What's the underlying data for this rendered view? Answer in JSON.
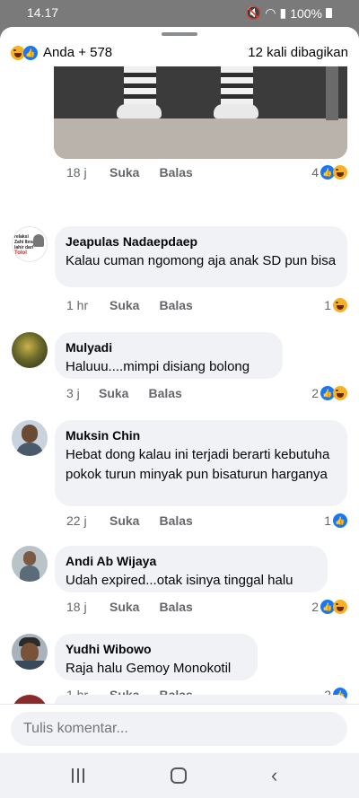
{
  "status_bar": {
    "time": "14.17",
    "battery": "100%",
    "signal_icons": [
      "mute-icon",
      "wifi-icon",
      "signal-icon",
      "battery-icon"
    ]
  },
  "header": {
    "reactors": "Anda + 578",
    "shares": "12 kali dibagikan",
    "reaction_icons": [
      "haha-icon",
      "like-icon"
    ]
  },
  "first_comment_meta": {
    "time": "18 j",
    "like": "Suka",
    "reply": "Balas",
    "reaction_count": "4"
  },
  "comments": [
    {
      "author": "Jeapulas Nadaepdaep",
      "text": "Kalau cuman ngomong aja anak SD  pun bisa",
      "time": "1 hr",
      "like": "Suka",
      "reply": "Balas",
      "reaction_count": "1"
    },
    {
      "author": "Mulyadi",
      "text": "Haluuu....mimpi disiang bolong",
      "time": "3 j",
      "like": "Suka",
      "reply": "Balas",
      "reaction_count": "2"
    },
    {
      "author": "Muksin Chin",
      "text": "Hebat dong kalau ini terjadi berarti kebutuha pokok turun minyak pun bisaturun harganya",
      "time": "22 j",
      "like": "Suka",
      "reply": "Balas",
      "reaction_count": "1"
    },
    {
      "author": "Andi Ab Wijaya",
      "text": "Udah expired...otak isinya tinggal halu",
      "time": "18 j",
      "like": "Suka",
      "reply": "Balas",
      "reaction_count": "2"
    },
    {
      "author": "Yudhi Wibowo",
      "text": "Raja halu Gemoy Monokotil",
      "time": "1 hr",
      "like": "Suka",
      "reply": "Balas",
      "reaction_count": "2"
    }
  ],
  "avatar_badge_text": [
    "relaksi",
    "Zahi Ibrahim",
    "lahir dari",
    "Tolol"
  ],
  "composer": {
    "placeholder": "Tulis komentar..."
  },
  "colors": {
    "accent": "#1877f2",
    "bubble": "#f0f2f5",
    "meta": "#65676b",
    "haha": "#f7b125"
  }
}
